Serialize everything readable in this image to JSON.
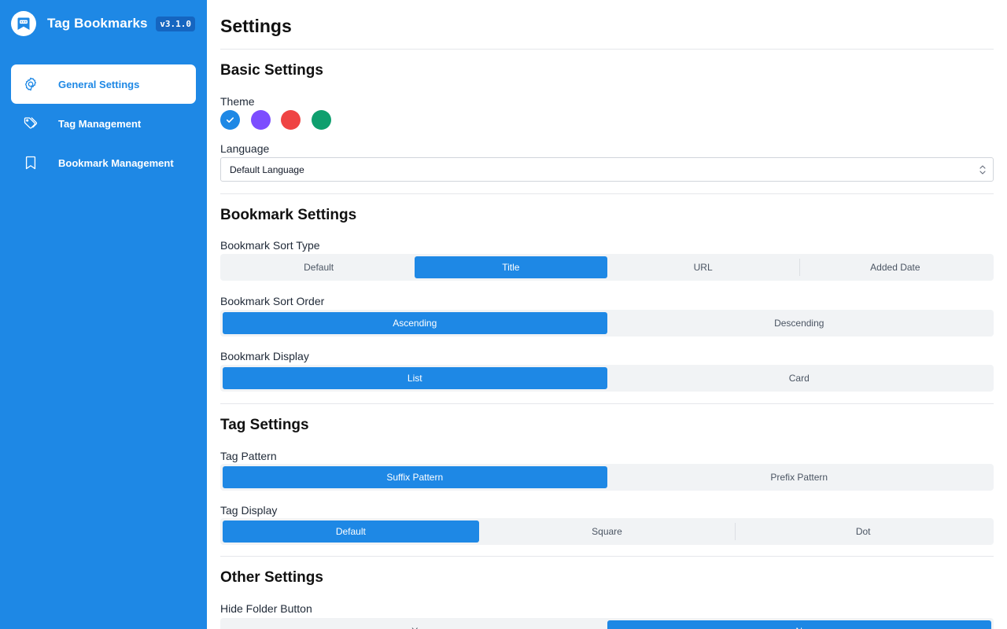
{
  "app": {
    "title": "Tag Bookmarks",
    "version": "v3.1.0",
    "logo_icon": "bookmark-chat-icon",
    "accent_color": "#1e88e5"
  },
  "sidebar": {
    "items": [
      {
        "label": "General Settings",
        "icon": "gear-icon",
        "active": true
      },
      {
        "label": "Tag Management",
        "icon": "tags-icon",
        "active": false
      },
      {
        "label": "Bookmark Management",
        "icon": "bookmark-icon",
        "active": false
      }
    ]
  },
  "page": {
    "title": "Settings"
  },
  "basic": {
    "title": "Basic Settings",
    "theme_label": "Theme",
    "themes": [
      {
        "color": "#1e88e5",
        "selected": true
      },
      {
        "color": "#7c4dff",
        "selected": false
      },
      {
        "color": "#ef4444",
        "selected": false
      },
      {
        "color": "#0e9f6e",
        "selected": false
      }
    ],
    "language_label": "Language",
    "language_value": "Default Language"
  },
  "bookmark": {
    "title": "Bookmark Settings",
    "sort_type_label": "Bookmark Sort Type",
    "sort_type_options": [
      "Default",
      "Title",
      "URL",
      "Added Date"
    ],
    "sort_type_selected": 1,
    "sort_order_label": "Bookmark Sort Order",
    "sort_order_options": [
      "Ascending",
      "Descending"
    ],
    "sort_order_selected": 0,
    "display_label": "Bookmark Display",
    "display_options": [
      "List",
      "Card"
    ],
    "display_selected": 0
  },
  "tag": {
    "title": "Tag Settings",
    "pattern_label": "Tag Pattern",
    "pattern_options": [
      "Suffix Pattern",
      "Prefix Pattern"
    ],
    "pattern_selected": 0,
    "display_label": "Tag Display",
    "display_options": [
      "Default",
      "Square",
      "Dot"
    ],
    "display_selected": 0
  },
  "other": {
    "title": "Other Settings",
    "hide_folder_label": "Hide Folder Button",
    "hide_folder_options": [
      "Y",
      "N"
    ],
    "hide_folder_selected": 1
  }
}
